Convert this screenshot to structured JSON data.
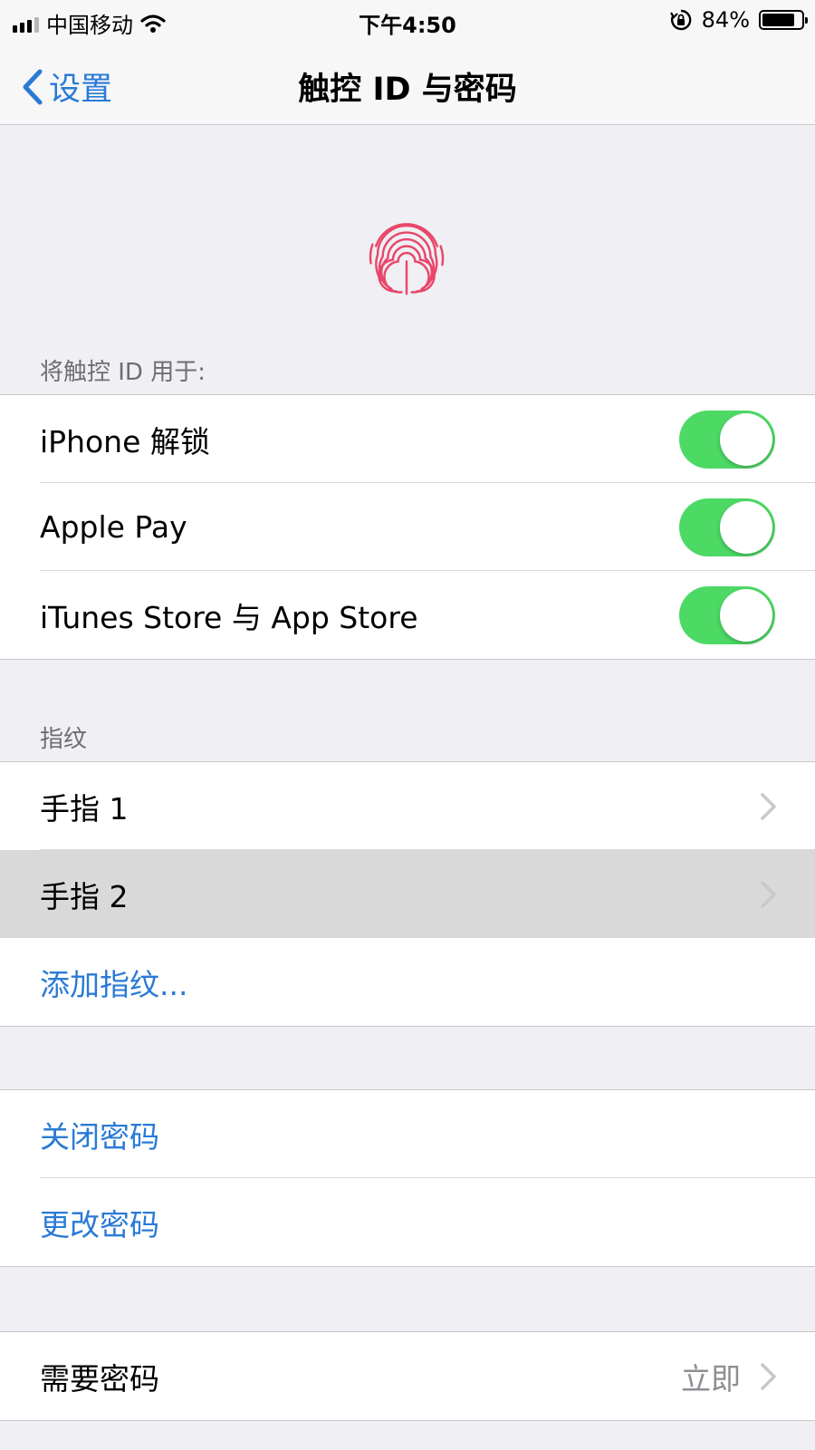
{
  "status_bar": {
    "carrier": "中国移动",
    "time": "下午4:50",
    "battery_percent": "84%",
    "battery_level": 0.84,
    "icons": [
      "signal-icon",
      "wifi-icon",
      "rotation-lock-icon",
      "battery-icon"
    ]
  },
  "nav": {
    "back_label": "设置",
    "title": "触控 ID 与密码"
  },
  "touch_id": {
    "icon": "fingerprint-icon",
    "icon_color": "#e8476a",
    "header": "将触控 ID 用于:",
    "options": [
      {
        "label": "iPhone 解锁",
        "enabled": true
      },
      {
        "label": "Apple Pay",
        "enabled": true
      },
      {
        "label": "iTunes Store 与 App Store",
        "enabled": true
      }
    ]
  },
  "fingerprints": {
    "header": "指纹",
    "items": [
      {
        "label": "手指 1"
      },
      {
        "label": "手指 2"
      }
    ],
    "add_label": "添加指纹..."
  },
  "passcode": {
    "turn_off_label": "关闭密码",
    "change_label": "更改密码"
  },
  "require_passcode": {
    "label": "需要密码",
    "value": "立即"
  },
  "colors": {
    "accent": "#2a7ad6",
    "toggle_on": "#4cd964",
    "background": "#efeff4"
  }
}
